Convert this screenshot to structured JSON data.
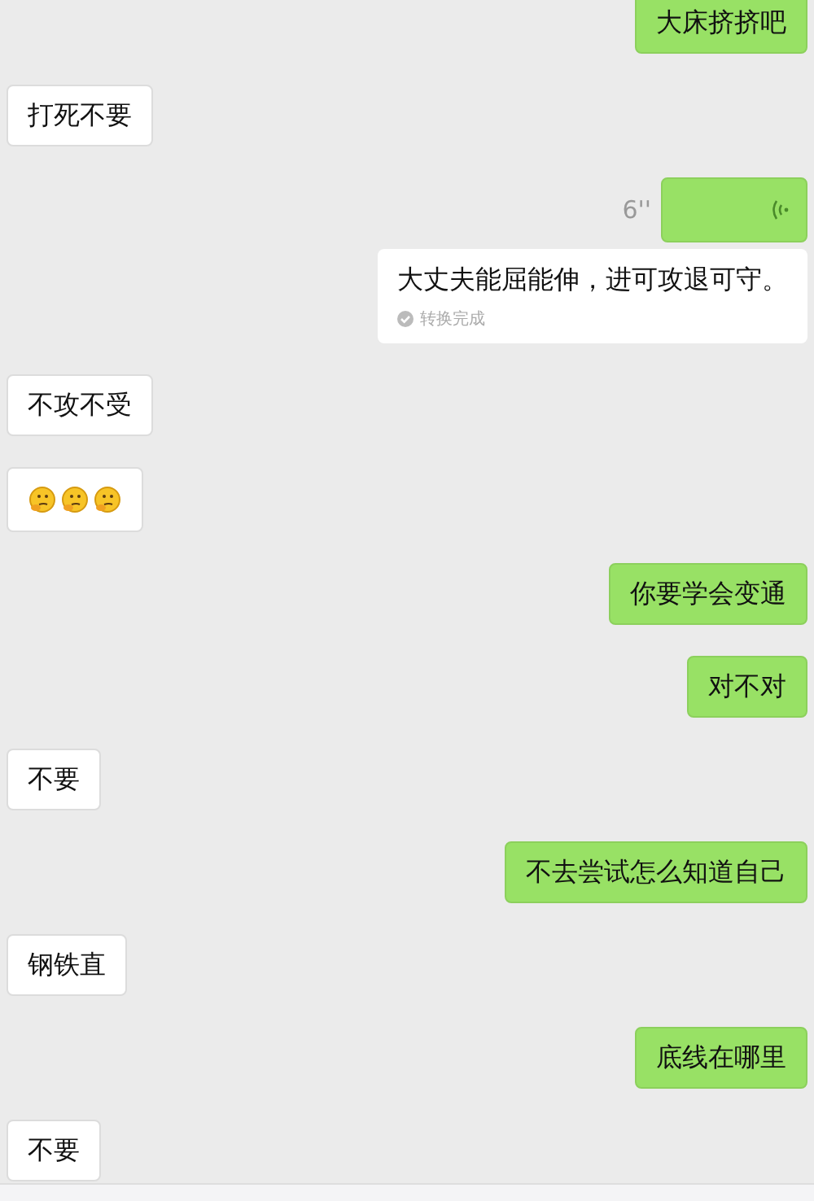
{
  "messages": [
    {
      "kind": "text",
      "outgoing": true,
      "text": "大床挤挤吧"
    },
    {
      "kind": "text",
      "outgoing": false,
      "text": "打死不要"
    },
    {
      "kind": "voice",
      "outgoing": true,
      "duration": "6''",
      "transcript": "大丈夫能屈能伸，进可攻退可守。",
      "transcript_status": "转换完成"
    },
    {
      "kind": "text",
      "outgoing": false,
      "text": "不攻不受"
    },
    {
      "kind": "emoji",
      "outgoing": false,
      "icons": [
        {
          "kind": "thinking"
        },
        {
          "kind": "thinking"
        },
        {
          "kind": "thinking"
        }
      ]
    },
    {
      "kind": "text",
      "outgoing": true,
      "text": "你要学会变通"
    },
    {
      "kind": "text",
      "outgoing": true,
      "text": "对不对"
    },
    {
      "kind": "text",
      "outgoing": false,
      "text": "不要"
    },
    {
      "kind": "text",
      "outgoing": true,
      "text": "不去尝试怎么知道自己"
    },
    {
      "kind": "text",
      "outgoing": false,
      "text": "钢铁直"
    },
    {
      "kind": "text",
      "outgoing": true,
      "text": "底线在哪里"
    },
    {
      "kind": "text",
      "outgoing": false,
      "text": "不要"
    }
  ]
}
